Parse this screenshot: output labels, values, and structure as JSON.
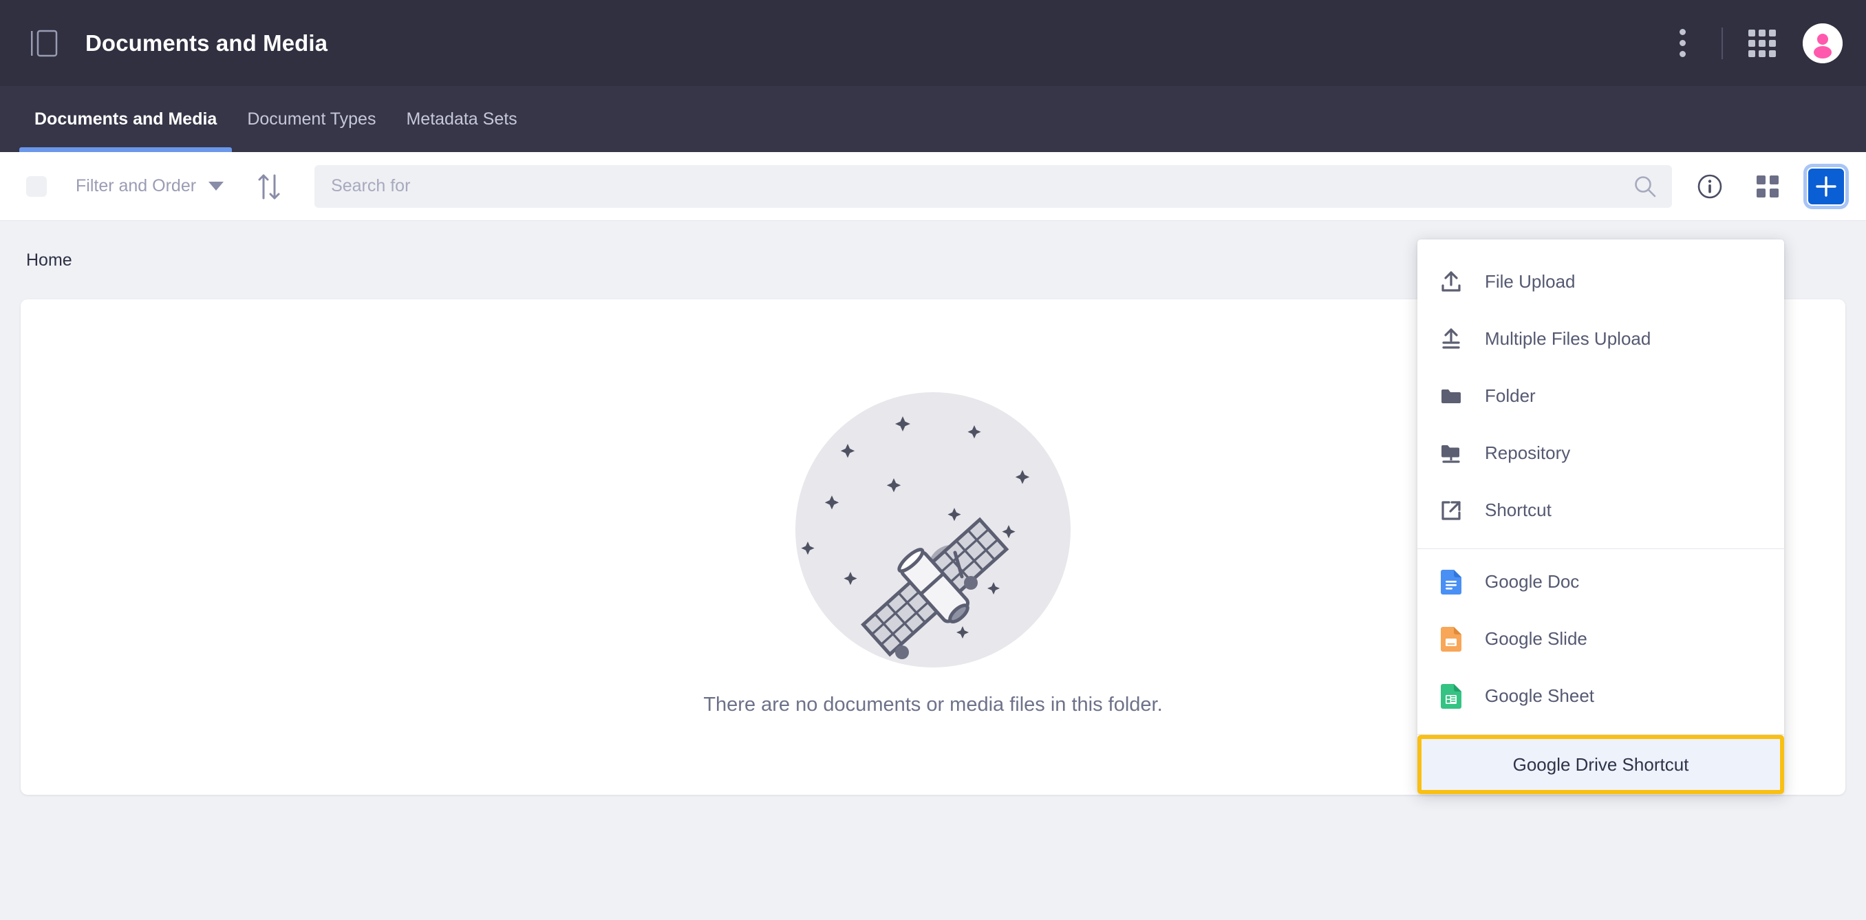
{
  "header": {
    "title": "Documents and Media",
    "panel_toggle_icon": "sidebar-panel-icon",
    "kebab_icon": "more-vertical-icon",
    "apps_icon": "apps-grid-icon",
    "avatar_icon": "user-avatar-icon"
  },
  "nav": {
    "tabs": [
      {
        "label": "Documents and Media",
        "active": true
      },
      {
        "label": "Document Types",
        "active": false
      },
      {
        "label": "Metadata Sets",
        "active": false
      }
    ]
  },
  "toolbar": {
    "select_all_checkbox": "select-all-checkbox",
    "filter_label": "Filter and Order",
    "sort_icon": "sort-arrows-icon",
    "search": {
      "value": "",
      "placeholder": "Search for"
    },
    "search_icon": "search-icon",
    "info_icon": "info-circle-icon",
    "view_toggle_icon": "grid-view-icon",
    "add_button_label": "+",
    "add_button_color": "#0b5fd4",
    "add_button_focus_ring": "#a8c5f5"
  },
  "breadcrumb": {
    "items": [
      "Home"
    ]
  },
  "empty_state": {
    "illustration": "satellite-in-space-illustration",
    "message": "There are no documents or media files in this folder."
  },
  "menu": {
    "groups": [
      {
        "items": [
          {
            "label": "File Upload",
            "icon": "upload-file-icon"
          },
          {
            "label": "Multiple Files Upload",
            "icon": "upload-multiple-files-icon"
          },
          {
            "label": "Folder",
            "icon": "folder-icon"
          },
          {
            "label": "Repository",
            "icon": "repository-icon"
          },
          {
            "label": "Shortcut",
            "icon": "external-link-shortcut-icon"
          }
        ]
      },
      {
        "items": [
          {
            "label": "Google Doc",
            "icon": "google-doc-icon",
            "color": "#4a90f4"
          },
          {
            "label": "Google Slide",
            "icon": "google-slide-icon",
            "color": "#f8a658"
          },
          {
            "label": "Google Sheet",
            "icon": "google-sheet-icon",
            "color": "#34c383"
          }
        ]
      }
    ],
    "highlighted_item": {
      "label": "Google Drive Shortcut",
      "highlight_color": "#f9c013",
      "background_color": "#eef2fb"
    }
  },
  "colors": {
    "topbar_bg": "#303040",
    "navbar_bg": "#363648",
    "active_tab_underline": "#6a97ea",
    "page_bg": "#f0f1f5",
    "card_bg": "#ffffff",
    "avatar_accent": "#ff59ad"
  }
}
